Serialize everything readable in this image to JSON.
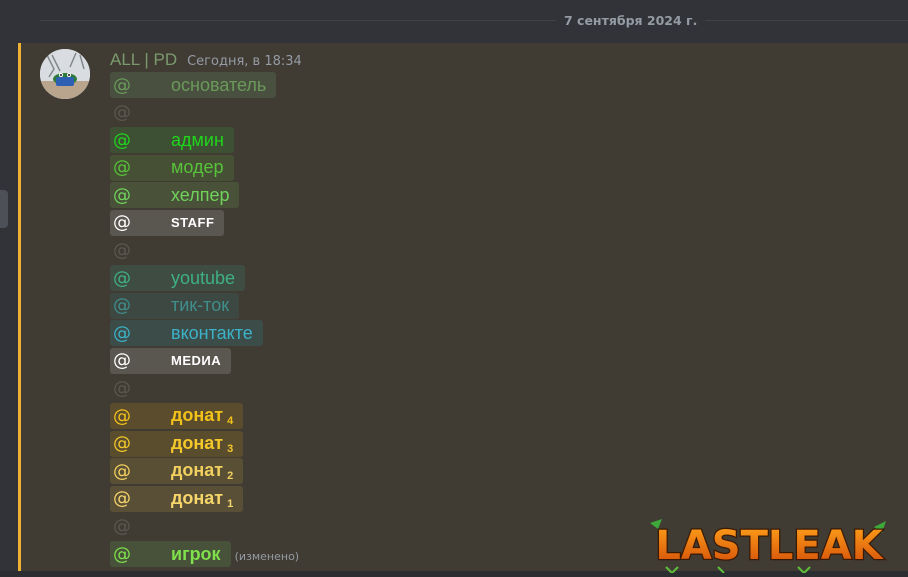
{
  "date_divider": "7 сентября 2024 г.",
  "message": {
    "author": "ALL | PD",
    "timestamp": "Сегодня, в 18:34",
    "edited_label": "(изменено)",
    "roles": [
      {
        "at": "@",
        "name": "основатель",
        "sub": "",
        "kind": "role",
        "color": "#6a9a5a",
        "bg": "#49503f",
        "bold": false
      },
      {
        "at": "@",
        "name": "",
        "sub": "",
        "kind": "empty",
        "color": "#5a5750",
        "bg": "transparent",
        "bold": false
      },
      {
        "at": "@",
        "name": "админ",
        "sub": "",
        "kind": "role",
        "color": "#1fd61c",
        "bg": "#3e5034",
        "bold": false
      },
      {
        "at": "@",
        "name": "модер",
        "sub": "",
        "kind": "role",
        "color": "#58c23a",
        "bg": "#455035",
        "bold": false
      },
      {
        "at": "@",
        "name": "хелпер",
        "sub": "",
        "kind": "role",
        "color": "#6fd35b",
        "bg": "#4a5139",
        "bold": false
      },
      {
        "at": "@",
        "name": "STAFF",
        "sub": "",
        "kind": "role",
        "color": "#ffffff",
        "bg": "#5a5650",
        "bold": true
      },
      {
        "at": "@",
        "name": "",
        "sub": "",
        "kind": "empty",
        "color": "#5a5750",
        "bg": "transparent",
        "bold": false
      },
      {
        "at": "@",
        "name": "youtube",
        "sub": "",
        "kind": "role",
        "color": "#3fb086",
        "bg": "#3e4c41",
        "bold": false
      },
      {
        "at": "@",
        "name": "тик-ток",
        "sub": "",
        "kind": "role",
        "color": "#3f8e8c",
        "bg": "#3d4842",
        "bold": false
      },
      {
        "at": "@",
        "name": "вконтакте",
        "sub": "",
        "kind": "role",
        "color": "#3cb2c8",
        "bg": "#3c4c48",
        "bold": false
      },
      {
        "at": "@",
        "name": "MEDИA",
        "sub": "",
        "kind": "role",
        "color": "#ffffff",
        "bg": "#5a5650",
        "bold": true
      },
      {
        "at": "@",
        "name": "",
        "sub": "",
        "kind": "empty",
        "color": "#5a5750",
        "bg": "transparent",
        "bold": false
      },
      {
        "at": "@",
        "name": "донат",
        "sub": "4",
        "kind": "role",
        "color": "#f2c21a",
        "bg": "#5a4c2c",
        "bold": true
      },
      {
        "at": "@",
        "name": "донат",
        "sub": "3",
        "kind": "role",
        "color": "#f4c82a",
        "bg": "#5a4d2e",
        "bold": true
      },
      {
        "at": "@",
        "name": "донат",
        "sub": "2",
        "kind": "role",
        "color": "#f1d060",
        "bg": "#594f35",
        "bold": true
      },
      {
        "at": "@",
        "name": "донат",
        "sub": "1",
        "kind": "role",
        "color": "#f6d56a",
        "bg": "#594f36",
        "bold": true
      },
      {
        "at": "@",
        "name": "",
        "sub": "",
        "kind": "empty",
        "color": "#5a5750",
        "bg": "transparent",
        "bold": false
      },
      {
        "at": "@",
        "name": "игрок",
        "sub": "",
        "kind": "role",
        "color": "#7ee04a",
        "bg": "#48523a",
        "bold": true
      }
    ]
  },
  "watermark": "LASTLEAK",
  "colors": {
    "background": "#313338",
    "highlight": "#403c33",
    "accent": "#f0b232",
    "muted": "#949ba4"
  }
}
